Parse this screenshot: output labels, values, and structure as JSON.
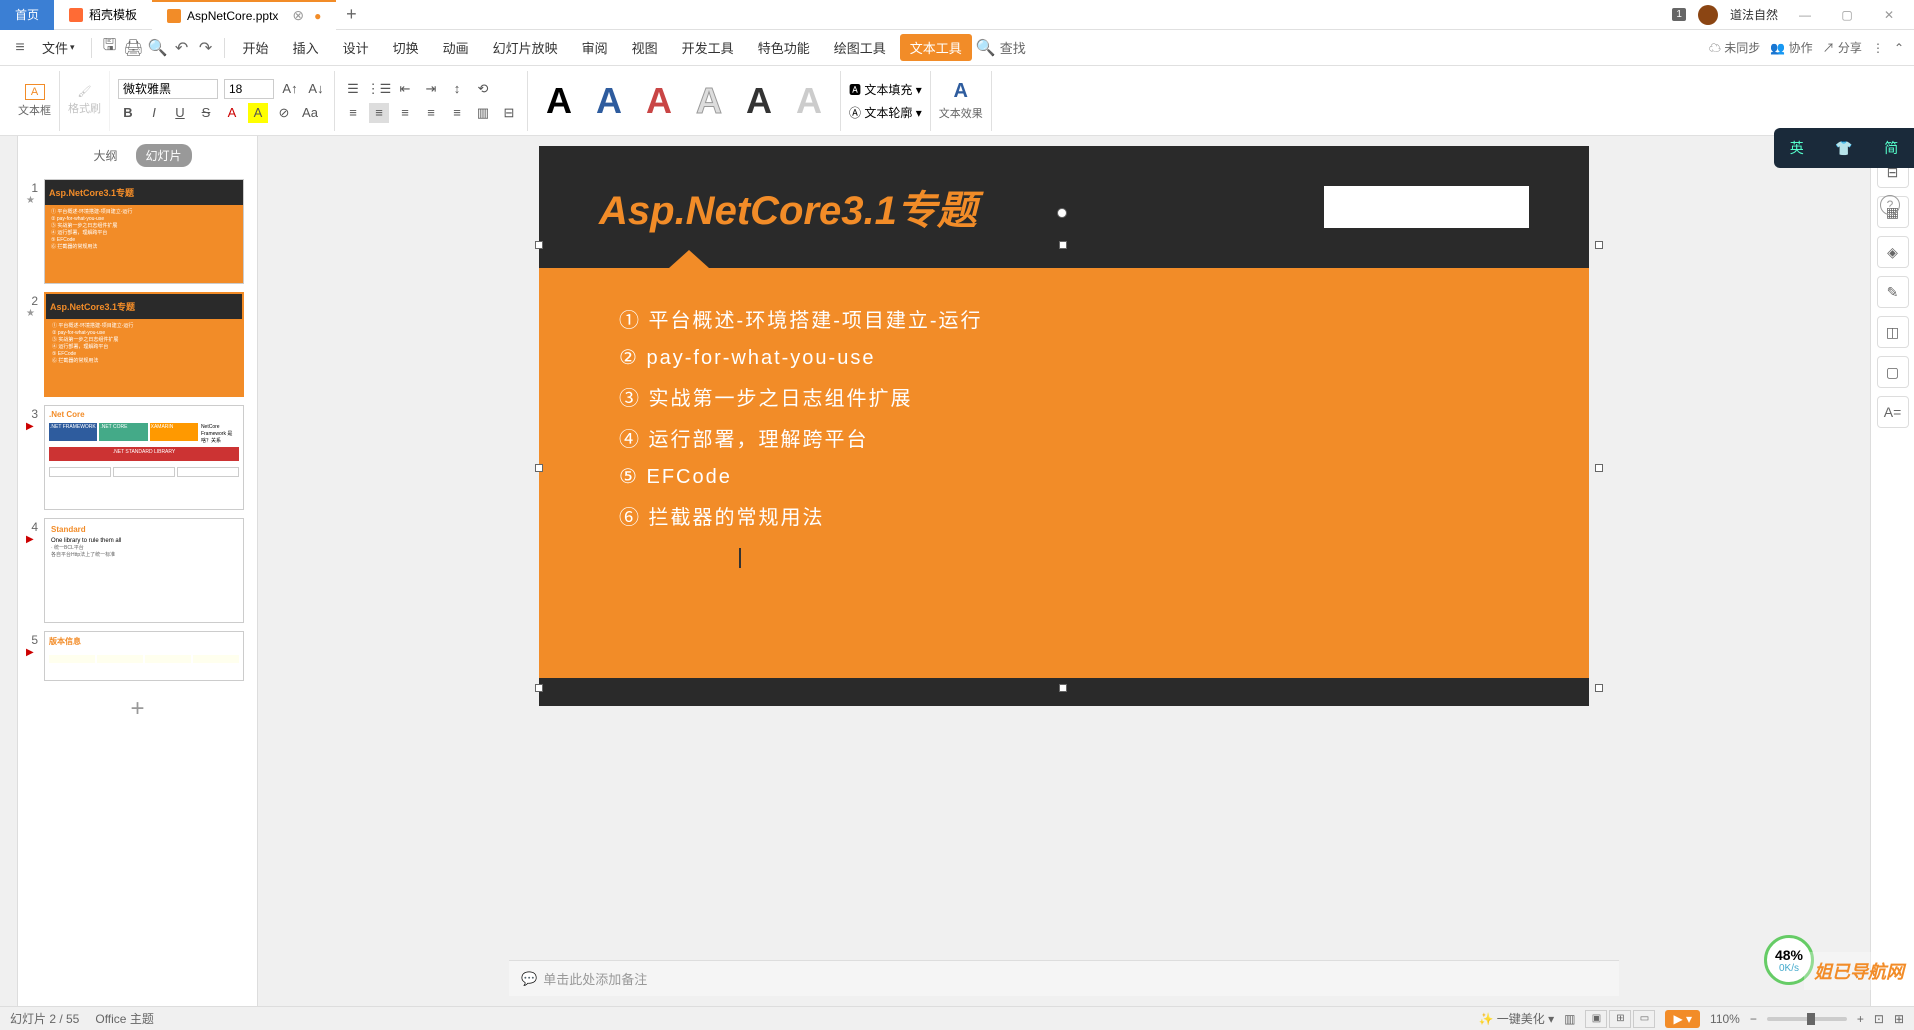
{
  "titlebar": {
    "home": "首页",
    "tab_dk": "稻壳模板",
    "tab_file": "AspNetCore.pptx",
    "user": "道法自然",
    "badge": "1"
  },
  "menubar": {
    "file": "文件",
    "items": [
      "开始",
      "插入",
      "设计",
      "切换",
      "动画",
      "幻灯片放映",
      "审阅",
      "视图",
      "开发工具",
      "特色功能",
      "绘图工具",
      "文本工具"
    ],
    "search": "查找",
    "sync": "未同步",
    "collab": "协作",
    "share": "分享"
  },
  "toolbar": {
    "textbox": "文本框",
    "fmtpaint": "格式刷",
    "font": "微软雅黑",
    "size": "18",
    "textfill": "文本填充",
    "textoutline": "文本轮廓",
    "texteffect": "文本效果"
  },
  "thumbs": {
    "outline": "大纲",
    "slides": "幻灯片",
    "t1": "Asp.NetCore3.1专题",
    "t1_lines": [
      "① 平台概述-环境搭建-项目建立-运行",
      "② pay-for-what-you-use",
      "③ 实战第一步之日志组件扩展",
      "④ 运行部署，理解跨平台",
      "⑤ EFCode",
      "⑥ 拦截器的常规用法"
    ],
    "t3": ".Net Core",
    "t4": "Standard",
    "t4_sub": "One library to rule them all",
    "t4_line": "· 统一BCL平台",
    "t4_line2": "各自平台Http法上了统一标准",
    "t5": "版本信息"
  },
  "slide": {
    "title": "Asp.NetCore3.1专题",
    "items": [
      "① 平台概述-环境搭建-项目建立-运行",
      "② pay-for-what-you-use",
      "③ 实战第一步之日志组件扩展",
      "④ 运行部署，理解跨平台",
      "⑤ EFCode",
      "⑥ 拦截器的常规用法"
    ]
  },
  "notes": "单击此处添加备注",
  "status": {
    "slide": "幻灯片 2 / 55",
    "theme": "Office 主题",
    "beautify": "一键美化",
    "zoom": "110%"
  },
  "float": {
    "en": "英",
    "cn": "简"
  },
  "speed": {
    "pct": "48%",
    "rate": "0K/s"
  },
  "watermark": "姐已导航网"
}
